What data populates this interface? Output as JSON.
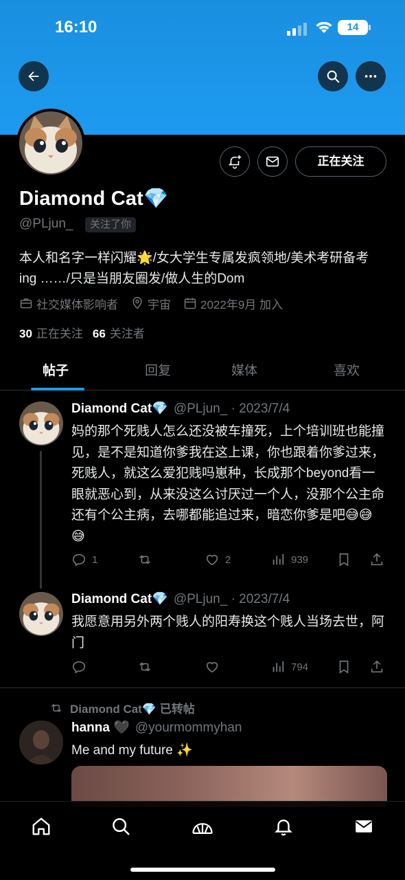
{
  "status_bar": {
    "time": "16:10",
    "battery": "14"
  },
  "header": {
    "back_icon": "arrow-left-icon",
    "search_icon": "search-icon",
    "more_icon": "more-horizontal-icon"
  },
  "profile": {
    "name": "Diamond Cat💎",
    "handle": "@PLjun_",
    "follows_you": "关注了你",
    "bio": "本人和名字一样闪耀🌟/女大学生专属发疯领地/美术考研备考ing ……/只是当朋友圈发/做人生的Dom",
    "category": "社交媒体影响者",
    "location": "宇宙",
    "joined": "2022年9月 加入",
    "following_count": "30",
    "following_label": "正在关注",
    "followers_count": "66",
    "followers_label": "关注者",
    "follow_button": "正在关注"
  },
  "tabs": [
    "帖子",
    "回复",
    "媒体",
    "喜欢"
  ],
  "posts": [
    {
      "name": "Diamond Cat💎",
      "meta": "@PLjun_ · 2023/7/4",
      "text": "妈的那个死贱人怎么还没被车撞死，上个培训班也能撞见，是不是知道你爹我在这上课，你也跟着你爹过来，死贱人，就这么爱犯贱吗崽种，长成那个beyond看一眼就恶心到，从来没这么讨厌过一个人，没那个公主命还有个公主病，去哪都能追过来，暗恋你爹是吧😅😅😅",
      "replies": "1",
      "reposts": "",
      "likes": "2",
      "views": "939"
    },
    {
      "name": "Diamond Cat💎",
      "meta": "@PLjun_ · 2023/7/4",
      "text": "我愿意用另外两个贱人的阳寿换这个贱人当场去世，阿门",
      "replies": "",
      "reposts": "",
      "likes": "",
      "views": "794"
    }
  ],
  "repost": {
    "label": "Diamond Cat💎 已转帖",
    "name": "hanna 🖤",
    "handle": "@yourmommyhan",
    "text": "Me and my future ✨"
  },
  "bottom_nav": [
    "home-icon",
    "search-icon",
    "communities-icon",
    "notifications-icon",
    "messages-icon"
  ]
}
